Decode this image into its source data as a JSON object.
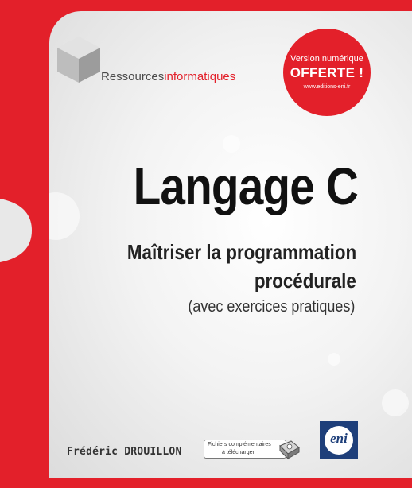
{
  "brand": {
    "part1": "Ressources",
    "part2": "informatiques"
  },
  "badge": {
    "line1": "Version numérique",
    "line2": "OFFERTE !",
    "line3": "www.editions-eni.fr"
  },
  "book": {
    "title": "Langage C",
    "subtitle_line1": "Maîtriser la programmation",
    "subtitle_line2": "procédurale",
    "subtitle_line3": "(avec exercices pratiques)",
    "author": "Frédéric DROUILLON"
  },
  "download": {
    "line1": "Fichiers complémentaires",
    "line2": "à télécharger"
  },
  "publisher": {
    "logo_text": "eni"
  },
  "colors": {
    "accent_red": "#e3202a",
    "publisher_blue": "#1e3f7a"
  }
}
